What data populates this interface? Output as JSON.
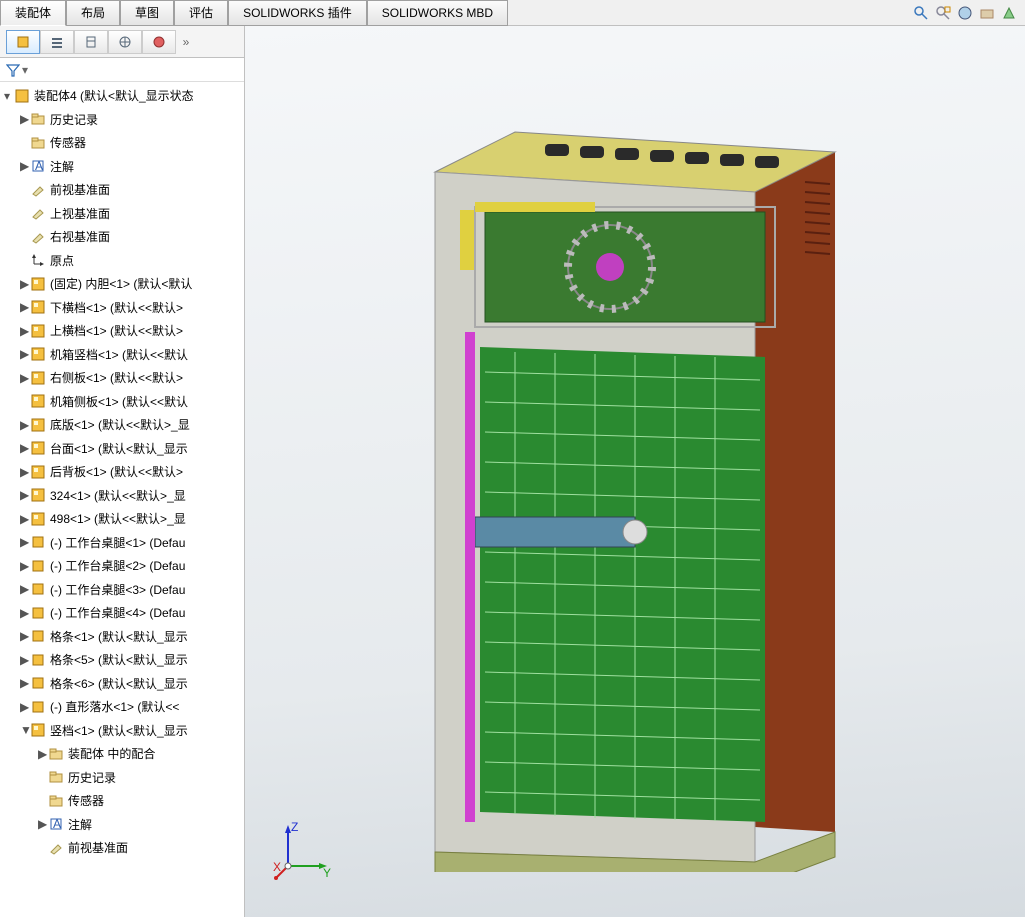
{
  "tabs": [
    "装配体",
    "布局",
    "草图",
    "评估",
    "SOLIDWORKS 插件",
    "SOLIDWORKS MBD"
  ],
  "activeTab": 0,
  "topIcons": [
    "zoom-fit-icon",
    "zoom-area-icon",
    "appearance-icon",
    "scene-icon",
    "display-icon"
  ],
  "sidebarTabIcons": [
    "fm-tree-icon",
    "property-icon",
    "config-icon",
    "display-pane-icon",
    "appearance-pane-icon"
  ],
  "tree": {
    "root": "装配体4 (默认<默认_显示状态",
    "items": [
      {
        "tri": "▶",
        "ic": "folder",
        "txt": "历史记录",
        "ind": 1
      },
      {
        "tri": "",
        "ic": "folder",
        "txt": "传感器",
        "ind": 1
      },
      {
        "tri": "▶",
        "ic": "annot",
        "txt": "注解",
        "ind": 1
      },
      {
        "tri": "",
        "ic": "plane",
        "txt": "前视基准面",
        "ind": 1
      },
      {
        "tri": "",
        "ic": "plane",
        "txt": "上视基准面",
        "ind": 1
      },
      {
        "tri": "",
        "ic": "plane",
        "txt": "右视基准面",
        "ind": 1
      },
      {
        "tri": "",
        "ic": "origin",
        "txt": "原点",
        "ind": 1
      },
      {
        "tri": "▶",
        "ic": "asm",
        "txt": "(固定) 内胆<1> (默认<默认",
        "ind": 1
      },
      {
        "tri": "▶",
        "ic": "asm",
        "txt": "下横档<1> (默认<<默认>",
        "ind": 1
      },
      {
        "tri": "▶",
        "ic": "asm",
        "txt": "上横档<1> (默认<<默认>",
        "ind": 1
      },
      {
        "tri": "▶",
        "ic": "asm",
        "txt": "机箱竖档<1> (默认<<默认",
        "ind": 1
      },
      {
        "tri": "▶",
        "ic": "asm",
        "txt": "右侧板<1> (默认<<默认>",
        "ind": 1
      },
      {
        "tri": "",
        "ic": "asm",
        "txt": "机箱侧板<1> (默认<<默认",
        "ind": 1
      },
      {
        "tri": "▶",
        "ic": "asm",
        "txt": "底版<1> (默认<<默认>_显",
        "ind": 1
      },
      {
        "tri": "▶",
        "ic": "asm",
        "txt": "台面<1> (默认<默认_显示",
        "ind": 1
      },
      {
        "tri": "▶",
        "ic": "asm",
        "txt": "后背板<1> (默认<<默认>",
        "ind": 1
      },
      {
        "tri": "▶",
        "ic": "asm",
        "txt": "324<1> (默认<<默认>_显",
        "ind": 1
      },
      {
        "tri": "▶",
        "ic": "asm",
        "txt": "498<1> (默认<<默认>_显",
        "ind": 1
      },
      {
        "tri": "▶",
        "ic": "part",
        "txt": "(-) 工作台桌腿<1> (Defau",
        "ind": 1
      },
      {
        "tri": "▶",
        "ic": "part",
        "txt": "(-) 工作台桌腿<2> (Defau",
        "ind": 1
      },
      {
        "tri": "▶",
        "ic": "part",
        "txt": "(-) 工作台桌腿<3> (Defau",
        "ind": 1
      },
      {
        "tri": "▶",
        "ic": "part",
        "txt": "(-) 工作台桌腿<4> (Defau",
        "ind": 1
      },
      {
        "tri": "▶",
        "ic": "part",
        "txt": "格条<1> (默认<默认_显示",
        "ind": 1
      },
      {
        "tri": "▶",
        "ic": "part",
        "txt": "格条<5> (默认<默认_显示",
        "ind": 1
      },
      {
        "tri": "▶",
        "ic": "part",
        "txt": "格条<6> (默认<默认_显示",
        "ind": 1
      },
      {
        "tri": "▶",
        "ic": "part",
        "txt": "(-) 直形落水<1> (默认<<",
        "ind": 1
      },
      {
        "tri": "▼",
        "ic": "asm",
        "txt": "竖档<1> (默认<默认_显示",
        "ind": 1
      },
      {
        "tri": "▶",
        "ic": "folder",
        "txt": "装配体 中的配合",
        "ind": 2
      },
      {
        "tri": "",
        "ic": "folder",
        "txt": "历史记录",
        "ind": 2
      },
      {
        "tri": "",
        "ic": "folder",
        "txt": "传感器",
        "ind": 2
      },
      {
        "tri": "▶",
        "ic": "annot",
        "txt": "注解",
        "ind": 2
      },
      {
        "tri": "",
        "ic": "plane",
        "txt": "前视基准面",
        "ind": 2
      }
    ]
  },
  "axes": {
    "x": "X",
    "y": "Y",
    "z": "Z"
  }
}
